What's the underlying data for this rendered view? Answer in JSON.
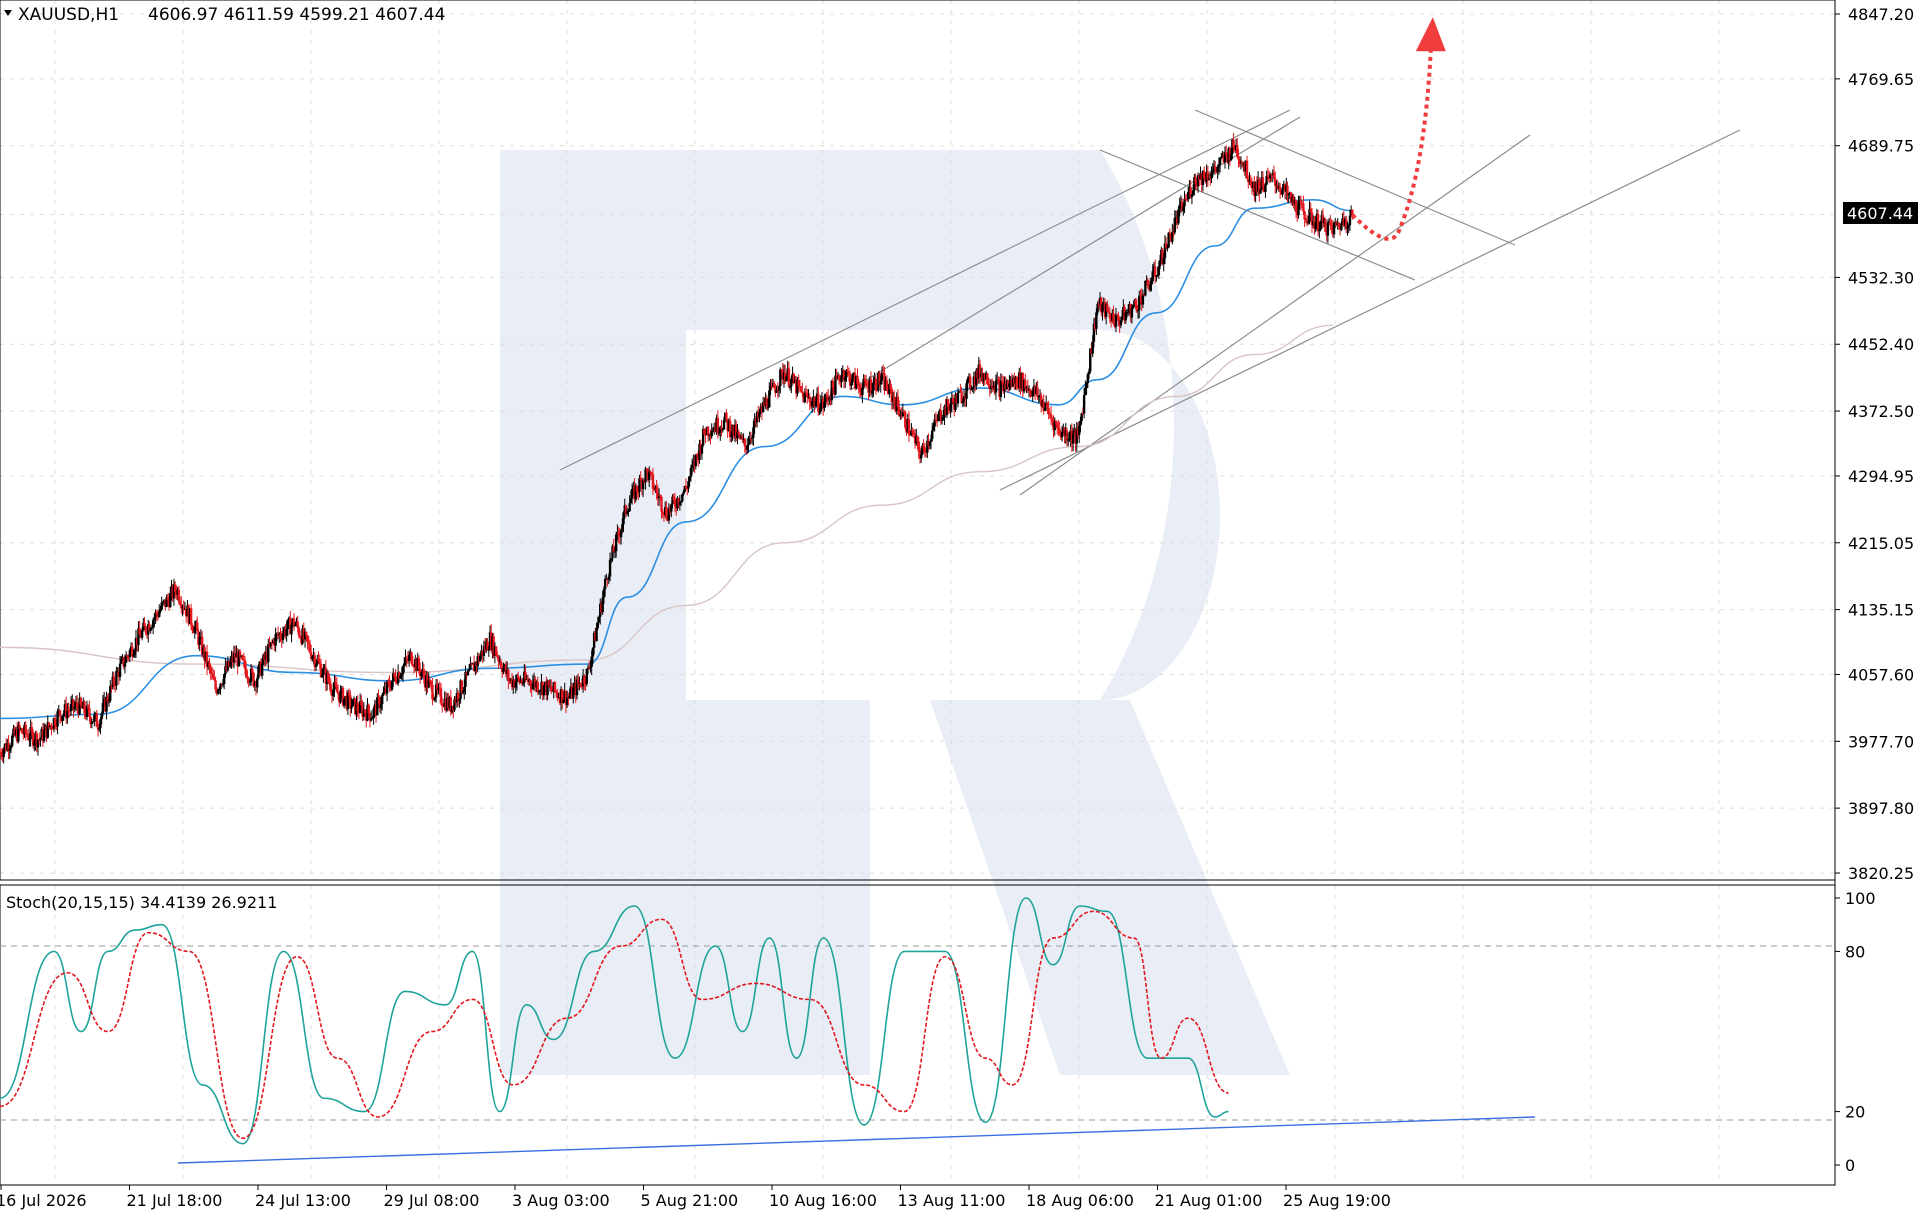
{
  "header": {
    "symbol": "XAUUSD,H1",
    "ohlc": "4606.97 4611.59 4599.21 4607.44"
  },
  "price_axis": {
    "ticks": [
      "4847.20",
      "4769.65",
      "4689.75",
      "4607.44",
      "4532.30",
      "4452.40",
      "4372.50",
      "4294.95",
      "4215.05",
      "4135.15",
      "4057.60",
      "3977.70",
      "3897.80",
      "3820.25"
    ],
    "current_price": "4607.44"
  },
  "stoch_panel": {
    "label": "Stoch(20,15,15) 34.4139 26.9211",
    "levels": [
      "100",
      "80",
      "20",
      "0"
    ]
  },
  "time_axis": {
    "ticks": [
      "16 Jul 2026",
      "21 Jul 18:00",
      "24 Jul 13:00",
      "29 Jul 08:00",
      "3 Aug 03:00",
      "5 Aug 21:00",
      "10 Aug 16:00",
      "13 Aug 11:00",
      "18 Aug 06:00",
      "21 Aug 01:00",
      "25 Aug 19:00"
    ]
  },
  "colors": {
    "bull_candle": "#000000",
    "bear_candle": "#e3171d",
    "ma_fast": "#2d8fe3",
    "ma_slow": "#d9c4c4",
    "stoch_main": "#1fa39a",
    "stoch_signal": "#e3171d",
    "trend_lines": "#8c8c8c",
    "stoch_support": "#3b6fe0",
    "forecast_arrow": "#f03c3c",
    "watermark": "#e9eef6"
  },
  "chart_data": {
    "type": "candlestick",
    "timeframe": "H1",
    "y_range": [
      3820.25,
      4847.2
    ],
    "close_path": [
      [
        0,
        3965
      ],
      [
        2,
        3990
      ],
      [
        4,
        3980
      ],
      [
        6,
        4010
      ],
      [
        8,
        4020
      ],
      [
        10,
        4000
      ],
      [
        12,
        4060
      ],
      [
        14,
        4100
      ],
      [
        16,
        4130
      ],
      [
        18,
        4160
      ],
      [
        20,
        4110
      ],
      [
        22,
        4040
      ],
      [
        24,
        4080
      ],
      [
        26,
        4050
      ],
      [
        28,
        4100
      ],
      [
        30,
        4120
      ],
      [
        32,
        4080
      ],
      [
        34,
        4040
      ],
      [
        36,
        4020
      ],
      [
        38,
        4010
      ],
      [
        40,
        4050
      ],
      [
        42,
        4080
      ],
      [
        44,
        4040
      ],
      [
        46,
        4020
      ],
      [
        48,
        4060
      ],
      [
        50,
        4100
      ],
      [
        52,
        4050
      ],
      [
        54,
        4050
      ],
      [
        56,
        4040
      ],
      [
        58,
        4030
      ],
      [
        60,
        4060
      ],
      [
        62,
        4180
      ],
      [
        64,
        4260
      ],
      [
        66,
        4300
      ],
      [
        68,
        4250
      ],
      [
        70,
        4280
      ],
      [
        72,
        4350
      ],
      [
        74,
        4360
      ],
      [
        76,
        4330
      ],
      [
        78,
        4380
      ],
      [
        80,
        4420
      ],
      [
        82,
        4390
      ],
      [
        84,
        4380
      ],
      [
        86,
        4420
      ],
      [
        88,
        4400
      ],
      [
        90,
        4410
      ],
      [
        92,
        4370
      ],
      [
        94,
        4320
      ],
      [
        96,
        4370
      ],
      [
        98,
        4390
      ],
      [
        100,
        4420
      ],
      [
        102,
        4400
      ],
      [
        104,
        4410
      ],
      [
        106,
        4390
      ],
      [
        108,
        4350
      ],
      [
        110,
        4340
      ],
      [
        112,
        4500
      ],
      [
        114,
        4480
      ],
      [
        116,
        4500
      ],
      [
        118,
        4540
      ],
      [
        120,
        4600
      ],
      [
        122,
        4650
      ],
      [
        124,
        4660
      ],
      [
        126,
        4690
      ],
      [
        128,
        4640
      ],
      [
        130,
        4650
      ],
      [
        132,
        4620
      ],
      [
        134,
        4600
      ],
      [
        136,
        4590
      ],
      [
        138,
        4607
      ]
    ],
    "ma_fast_path": [
      [
        0,
        4005
      ],
      [
        10,
        4010
      ],
      [
        20,
        4080
      ],
      [
        30,
        4060
      ],
      [
        40,
        4050
      ],
      [
        50,
        4065
      ],
      [
        60,
        4070
      ],
      [
        64,
        4150
      ],
      [
        70,
        4240
      ],
      [
        78,
        4330
      ],
      [
        86,
        4390
      ],
      [
        92,
        4380
      ],
      [
        100,
        4400
      ],
      [
        108,
        4380
      ],
      [
        112,
        4410
      ],
      [
        118,
        4490
      ],
      [
        124,
        4570
      ],
      [
        128,
        4615
      ],
      [
        134,
        4625
      ],
      [
        138,
        4612
      ]
    ],
    "ma_slow_path": [
      [
        0,
        4090
      ],
      [
        20,
        4070
      ],
      [
        40,
        4060
      ],
      [
        60,
        4075
      ],
      [
        70,
        4140
      ],
      [
        80,
        4215
      ],
      [
        90,
        4260
      ],
      [
        100,
        4300
      ],
      [
        110,
        4330
      ],
      [
        120,
        4390
      ],
      [
        128,
        4440
      ],
      [
        136,
        4475
      ]
    ],
    "forecast": {
      "from": [
        138,
        4607
      ],
      "dip": [
        142,
        4590
      ],
      "target": [
        146,
        4805
      ]
    },
    "stochastic": {
      "params": [
        20,
        15,
        15
      ],
      "main_value": 34.4139,
      "signal_value": 26.9211,
      "main_path": [
        [
          0,
          25
        ],
        [
          4,
          80
        ],
        [
          6,
          50
        ],
        [
          8,
          80
        ],
        [
          10,
          88
        ],
        [
          12,
          90
        ],
        [
          15,
          30
        ],
        [
          18,
          8
        ],
        [
          21,
          80
        ],
        [
          24,
          25
        ],
        [
          27,
          20
        ],
        [
          30,
          65
        ],
        [
          33,
          60
        ],
        [
          35,
          80
        ],
        [
          37,
          20
        ],
        [
          39,
          60
        ],
        [
          41,
          47
        ],
        [
          44,
          80
        ],
        [
          47,
          97
        ],
        [
          50,
          40
        ],
        [
          53,
          82
        ],
        [
          55,
          50
        ],
        [
          57,
          85
        ],
        [
          59,
          40
        ],
        [
          61,
          85
        ],
        [
          64,
          15
        ],
        [
          67,
          80
        ],
        [
          70,
          80
        ],
        [
          73,
          16
        ],
        [
          76,
          100
        ],
        [
          78,
          75
        ],
        [
          80,
          97
        ],
        [
          82,
          95
        ],
        [
          85,
          40
        ],
        [
          88,
          40
        ],
        [
          90,
          18
        ],
        [
          91,
          20
        ]
      ],
      "signal_path": [
        [
          0,
          22
        ],
        [
          5,
          72
        ],
        [
          8,
          50
        ],
        [
          11,
          87
        ],
        [
          14,
          80
        ],
        [
          18,
          10
        ],
        [
          22,
          78
        ],
        [
          25,
          40
        ],
        [
          28,
          18
        ],
        [
          32,
          50
        ],
        [
          35,
          62
        ],
        [
          38,
          30
        ],
        [
          42,
          55
        ],
        [
          46,
          82
        ],
        [
          49,
          92
        ],
        [
          52,
          62
        ],
        [
          56,
          68
        ],
        [
          60,
          62
        ],
        [
          64,
          30
        ],
        [
          67,
          20
        ],
        [
          70,
          78
        ],
        [
          73,
          40
        ],
        [
          75,
          30
        ],
        [
          78,
          85
        ],
        [
          81,
          95
        ],
        [
          84,
          85
        ],
        [
          86,
          40
        ],
        [
          88,
          55
        ],
        [
          91,
          27
        ]
      ],
      "levels": [
        0,
        20,
        80,
        100
      ]
    }
  }
}
